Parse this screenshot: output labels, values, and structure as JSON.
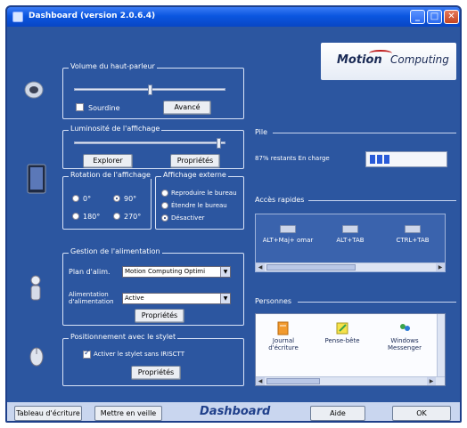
{
  "window": {
    "title": "Dashboard (version 2.0.6.4)",
    "minimize": "_",
    "maximize": "□",
    "close": "✕"
  },
  "logo": {
    "word1": "Motion",
    "word2": "Computing"
  },
  "volume": {
    "label": "Volume du haut-parleur",
    "level": 0.5,
    "mute_label": "Sourdine",
    "advanced_button": "Avancé"
  },
  "brightness": {
    "label": "Luminosité de l'affichage",
    "level": 0.95,
    "explore_button": "Explorer",
    "properties_button": "Propriétés"
  },
  "rotation": {
    "label": "Rotation de l'affichage",
    "options": [
      "0°",
      "90°",
      "180°",
      "270°"
    ],
    "selected": "90°"
  },
  "external": {
    "label": "Affichage externe",
    "options": [
      "Reproduire le bureau",
      "Étendre le bureau",
      "Désactiver"
    ],
    "selected": "Désactiver"
  },
  "power": {
    "label": "Gestion de l'alimentation",
    "plan_label": "Plan d'alim.",
    "plan_value": "Motion Computing Optimi",
    "alarm_label": "Alimentation d'alimentation",
    "alarm_value": "Active",
    "properties_button": "Propriétés"
  },
  "pen": {
    "label": "Positionnement avec le stylet",
    "check_label": "Activer le stylet sans IRISCTT",
    "checked": true,
    "properties_button": "Propriétés"
  },
  "battery": {
    "label": "Pile",
    "status": "87% restants   En charge"
  },
  "shortcuts": {
    "label": "Accès rapides",
    "items": [
      "ALT+Maj+ omar",
      "ALT+TAB",
      "CTRL+TAB"
    ]
  },
  "apps": {
    "label": "Personnes",
    "items": [
      "Journal d'écriture",
      "Pense-bête",
      "Windows Messenger"
    ]
  },
  "footer": {
    "pc_button": "Tableau d'écriture",
    "standby_button": "Mettre en veille",
    "brand": "Dashboard",
    "help_button": "Aide",
    "ok_button": "OK"
  },
  "colors": {
    "panel_bg": "#2c56a0",
    "title_bar": "#0b56e0",
    "accent_red": "#c02020"
  }
}
